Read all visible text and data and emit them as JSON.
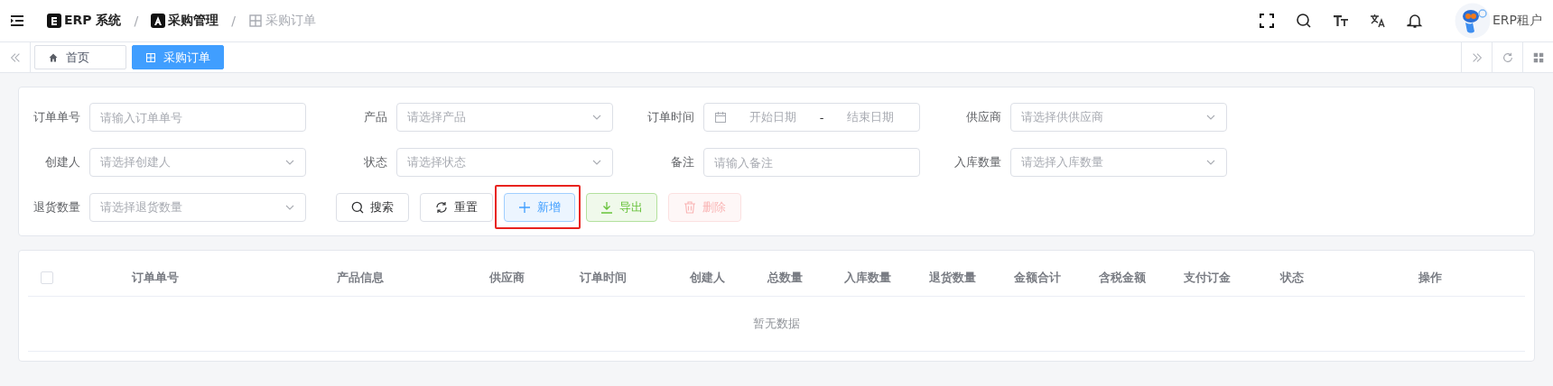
{
  "header": {
    "separator": "/",
    "breadcrumbs": [
      {
        "label": "ERP 系统",
        "kind": "system",
        "current": false
      },
      {
        "label": "采购管理",
        "kind": "module",
        "current": false
      },
      {
        "label": "采购订单",
        "kind": "page",
        "current": true
      }
    ],
    "user": {
      "name": "ERP租户"
    }
  },
  "tabs": [
    {
      "label": "首页",
      "kind": "home",
      "selected": false
    },
    {
      "label": "采购订单",
      "kind": "page",
      "selected": true
    }
  ],
  "filters": [
    {
      "label": "订单单号",
      "kind": "input",
      "placeholder": "请输入订单单号"
    },
    {
      "label": "产品",
      "kind": "select",
      "placeholder": "请选择产品"
    },
    {
      "label": "订单时间",
      "kind": "daterange",
      "start_placeholder": "开始日期",
      "separator": "-",
      "end_placeholder": "结束日期"
    },
    {
      "label": "供应商",
      "kind": "select",
      "placeholder": "请选择供供应商"
    },
    {
      "label": "创建人",
      "kind": "select",
      "placeholder": "请选择创建人"
    },
    {
      "label": "状态",
      "kind": "select",
      "placeholder": "请选择状态"
    },
    {
      "label": "备注",
      "kind": "input",
      "placeholder": "请输入备注"
    },
    {
      "label": "入库数量",
      "kind": "select",
      "placeholder": "请选择入库数量"
    },
    {
      "label": "退货数量",
      "kind": "select",
      "placeholder": "请选择退货数量"
    }
  ],
  "buttons": [
    {
      "label": "搜索",
      "kind": "search",
      "disabled": false,
      "highlighted": false
    },
    {
      "label": "重置",
      "kind": "reset",
      "disabled": false,
      "highlighted": false
    },
    {
      "label": "新增",
      "kind": "add",
      "disabled": false,
      "highlighted": true
    },
    {
      "label": "导出",
      "kind": "export",
      "disabled": false,
      "highlighted": false
    },
    {
      "label": "删除",
      "kind": "delete",
      "disabled": true,
      "highlighted": false
    }
  ],
  "table": {
    "select_all": {
      "checked": false
    },
    "columns": [
      "订单单号",
      "产品信息",
      "供应商",
      "订单时间",
      "创建人",
      "总数量",
      "入库数量",
      "退货数量",
      "金额合计",
      "含税金额",
      "支付订金",
      "状态",
      "操作"
    ],
    "empty_text": "暂无数据"
  }
}
